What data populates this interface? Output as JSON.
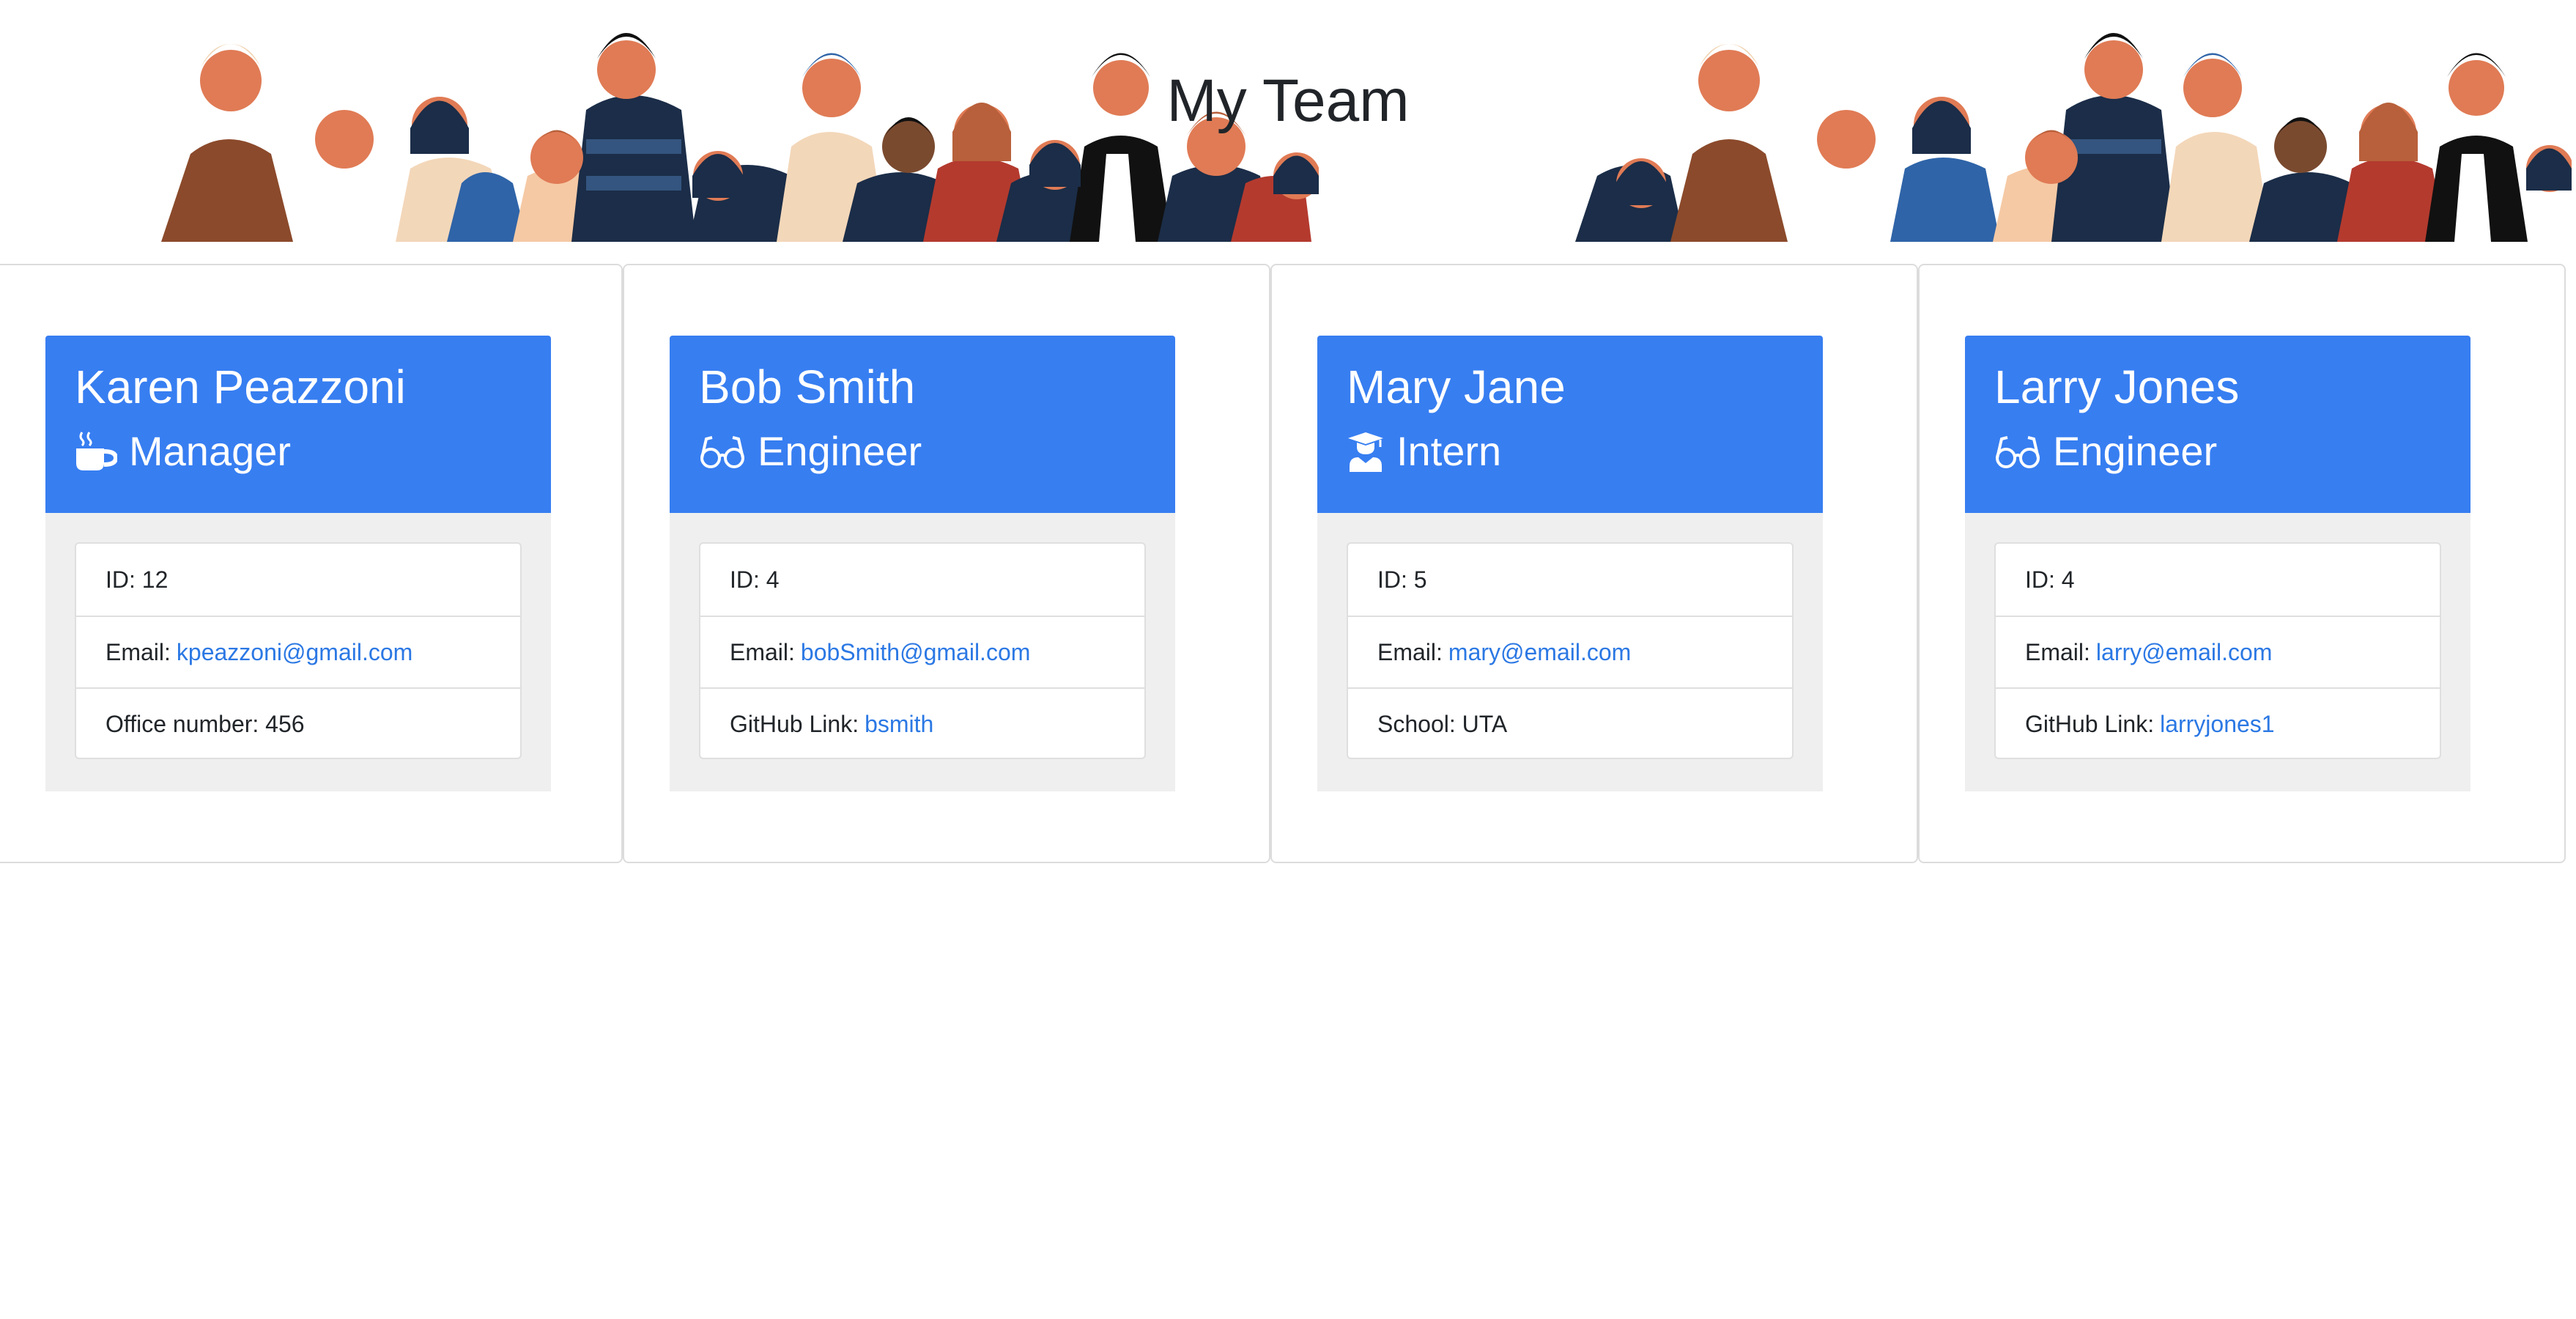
{
  "page": {
    "title": "My Team",
    "banner_image": "team-crowd-illustration"
  },
  "colors": {
    "card_header": "#377ef1",
    "card_body": "#efefef",
    "link": "#2b78e4",
    "text": "#212529"
  },
  "employees": [
    {
      "name": "Karen Peazzoni",
      "role": "Manager",
      "role_icon": "coffee-mug-icon",
      "id_text": "ID: 12",
      "email_label": "Email:",
      "email": "kpeazzoni@gmail.com",
      "extra_label": "Office number:",
      "extra_value": "456"
    },
    {
      "name": "Bob Smith",
      "role": "Engineer",
      "role_icon": "glasses-icon",
      "id_text": "ID: 4",
      "email_label": "Email:",
      "email": "bobSmith@gmail.com",
      "extra_label": "GitHub Link:",
      "extra_value": "bsmith"
    },
    {
      "name": "Mary Jane",
      "role": "Intern",
      "role_icon": "graduate-icon",
      "id_text": "ID: 5",
      "email_label": "Email:",
      "email": "mary@email.com",
      "extra_label": "School:",
      "extra_value": "UTA"
    },
    {
      "name": "Larry Jones",
      "role": "Engineer",
      "role_icon": "glasses-icon",
      "id_text": "ID: 4",
      "email_label": "Email:",
      "email": "larry@email.com",
      "extra_label": "GitHub Link:",
      "extra_value": "larryjones1"
    }
  ]
}
